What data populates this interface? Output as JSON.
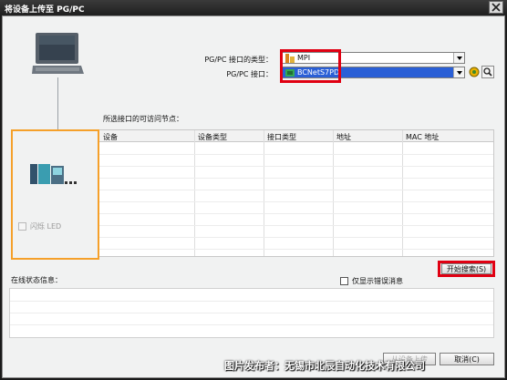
{
  "window": {
    "title": "将设备上传至 PG/PC"
  },
  "interface": {
    "type_label": "PG/PC 接口的类型：",
    "type_value": "MPI",
    "port_label": "PG/PC 接口：",
    "port_value": "BCNetS7PD"
  },
  "nodes": {
    "caption": "所选接口的可访问节点：",
    "columns": [
      "设备",
      "设备类型",
      "接口类型",
      "地址",
      "MAC 地址"
    ],
    "rows": []
  },
  "flash_led": {
    "label": "闪烁 LED",
    "checked": false
  },
  "search_button": {
    "label": "开始搜索(S)"
  },
  "status": {
    "label": "在线状态信息：",
    "show_errors_label": "仅显示错误消息",
    "show_errors_checked": false
  },
  "footer": {
    "upload_label": "从设备上传",
    "cancel_label": "取消(C)"
  },
  "watermark": "图片发布者：无锡市北辰自动化技术有限公司",
  "colors": {
    "highlight_red": "#e00012",
    "selection_blue": "#2a5fd6",
    "orange_frame": "#f5a02a"
  }
}
